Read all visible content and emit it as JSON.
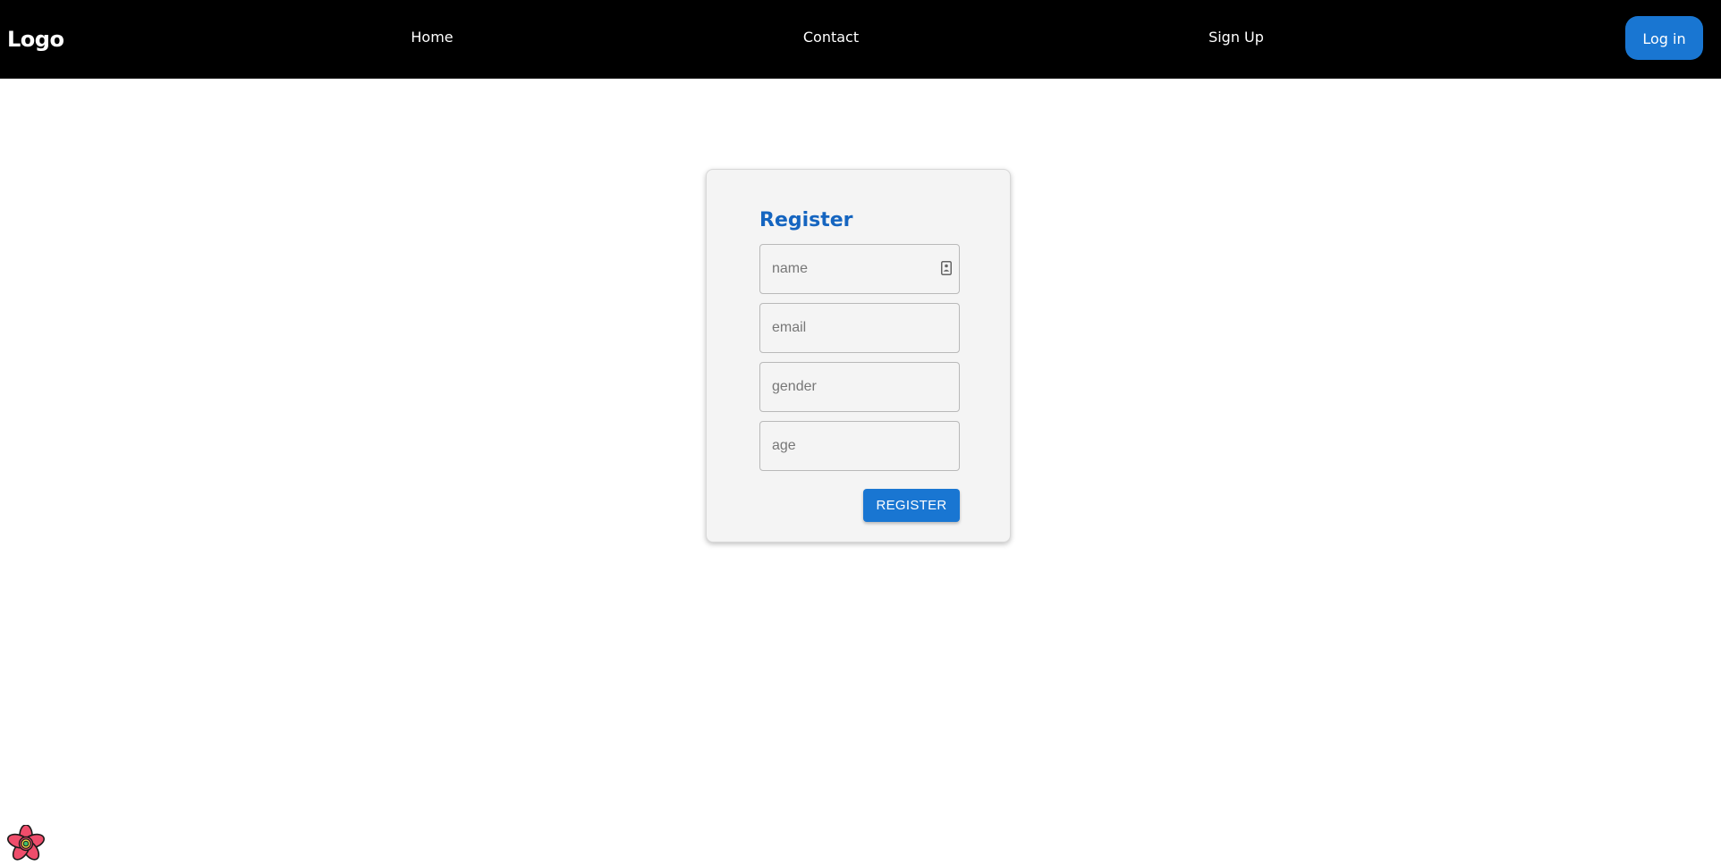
{
  "navbar": {
    "logo": "Logo",
    "links": [
      "Home",
      "Contact",
      "Sign Up"
    ],
    "login_label": "Log in"
  },
  "form": {
    "title": "Register",
    "fields": {
      "name": {
        "value": "",
        "placeholder": "name"
      },
      "email": {
        "value": "",
        "placeholder": "email"
      },
      "gender": {
        "value": "",
        "placeholder": "gender"
      },
      "age": {
        "value": "",
        "placeholder": "age"
      }
    },
    "submit_label": "REGISTER"
  },
  "icons": {
    "autofill": "contact-card-icon",
    "devtools": "react-query-devtools-flower-icon"
  },
  "colors": {
    "navbar_bg": "#000000",
    "primary": "#1976d2",
    "title": "#1565c0",
    "card_bg": "#f4f4f4"
  }
}
